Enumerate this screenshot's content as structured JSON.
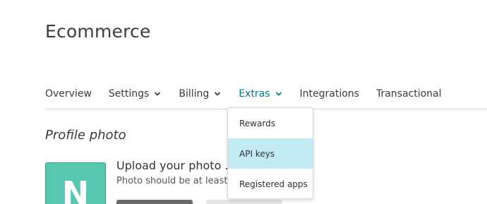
{
  "header": {
    "title": "Ecommerce"
  },
  "nav": {
    "items": [
      {
        "label": "Overview",
        "has_menu": false,
        "active": false
      },
      {
        "label": "Settings",
        "has_menu": true,
        "active": false
      },
      {
        "label": "Billing",
        "has_menu": true,
        "active": false
      },
      {
        "label": "Extras",
        "has_menu": true,
        "active": true
      },
      {
        "label": "Integrations",
        "has_menu": false,
        "active": false
      },
      {
        "label": "Transactional",
        "has_menu": false,
        "active": false
      }
    ],
    "active_color": "#007c89"
  },
  "extras_menu": {
    "items": [
      {
        "label": "Rewards",
        "highlighted": false
      },
      {
        "label": "API keys",
        "highlighted": true
      },
      {
        "label": "Registered apps",
        "highlighted": false
      }
    ],
    "highlight_color": "#c2eaf3"
  },
  "profile": {
    "section_title": "Profile photo",
    "avatar_initial": "N",
    "avatar_color": "#58c7b0",
    "upload_title": "Upload your photo ...",
    "upload_hint": "Photo should be at least 3"
  }
}
